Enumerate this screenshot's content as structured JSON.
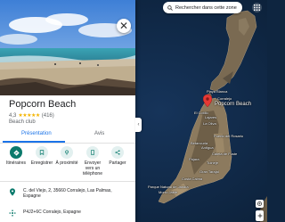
{
  "place": {
    "name": "Popcorn Beach",
    "rating": "4,3",
    "stars": "★★★★★",
    "review_count": "(416)",
    "category": "Beach club"
  },
  "tabs": [
    {
      "label": "Présentation"
    },
    {
      "label": "Avis"
    }
  ],
  "actions": [
    {
      "label": "Itinéraires",
      "icon": "directions-icon"
    },
    {
      "label": "Enregistrer",
      "icon": "bookmark-icon"
    },
    {
      "label": "À proximité",
      "icon": "nearby-icon"
    },
    {
      "label": "Envoyer vers un téléphone",
      "icon": "phone-icon"
    },
    {
      "label": "Partager",
      "icon": "share-icon"
    }
  ],
  "info": {
    "address": "C. del Viejo, 2, 35660 Corralejo, Las Palmas, Espagne",
    "plus_code": "P4J2+6C Corralejo, Espagne"
  },
  "map": {
    "search_area_label": "Rechercher dans cette zone",
    "pin_label": "Popcorn Beach",
    "places": [
      {
        "name": "Corralejo"
      },
      {
        "name": "El Cotillo"
      },
      {
        "name": "Lajares"
      },
      {
        "name": "La Oliva"
      },
      {
        "name": "Playa Blanca"
      },
      {
        "name": "Puerto del Rosario"
      },
      {
        "name": "Costa Calma"
      },
      {
        "name": "Morro Jable"
      },
      {
        "name": "Parque Natural de Jandía"
      },
      {
        "name": "Antigua"
      },
      {
        "name": "Pájara"
      },
      {
        "name": "Tuineje"
      },
      {
        "name": "Gran Tarajal"
      },
      {
        "name": "Betancuria"
      },
      {
        "name": "Caleta de Fuste"
      }
    ]
  },
  "colors": {
    "accent": "#1a73e8",
    "action_primary": "#0b7a6c",
    "pin": "#e53935",
    "ocean": "#0e2540"
  }
}
